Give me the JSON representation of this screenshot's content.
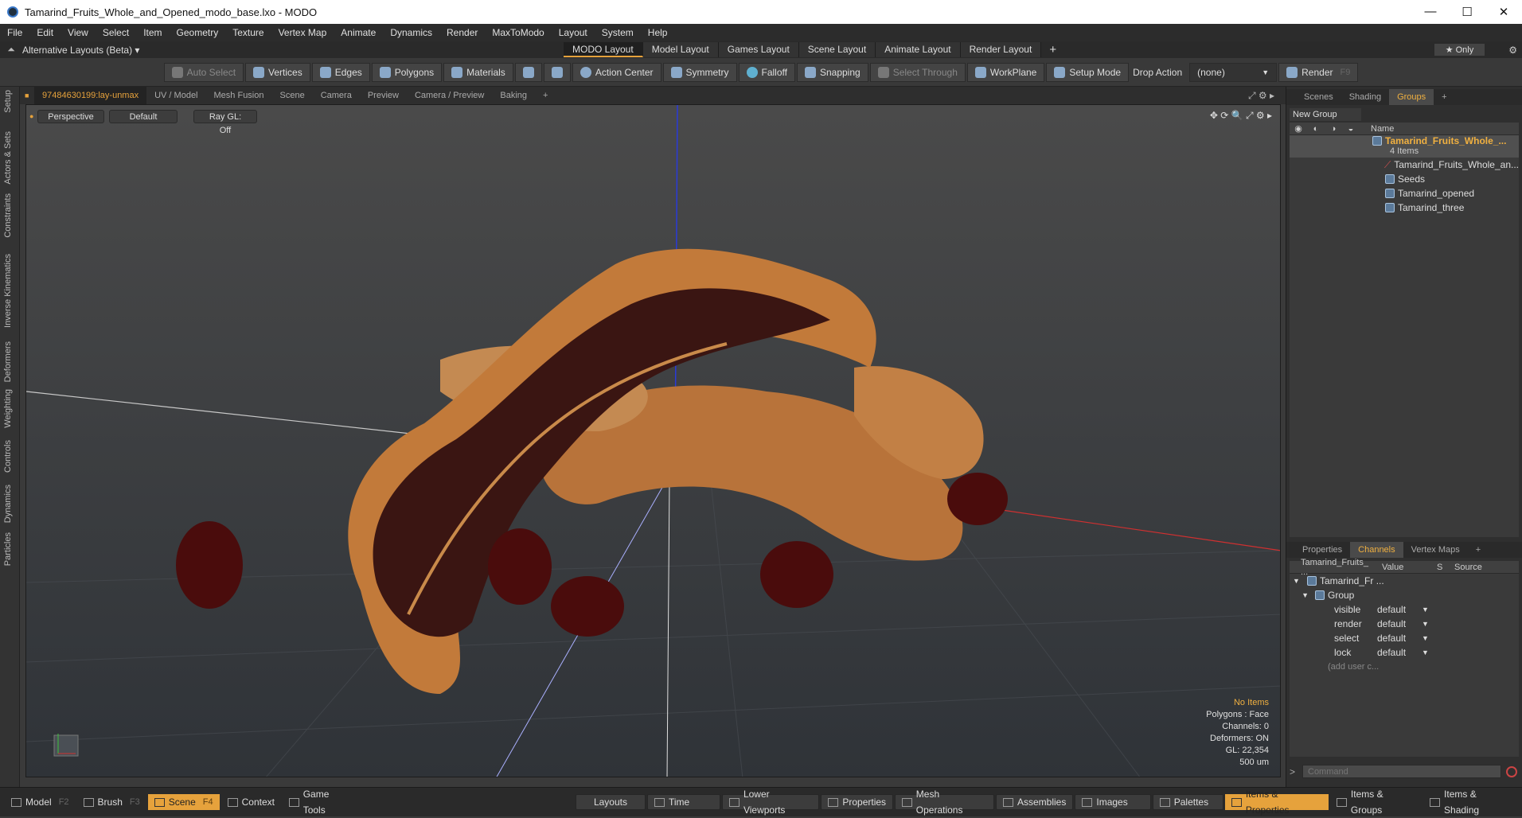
{
  "window": {
    "title": "Tamarind_Fruits_Whole_and_Opened_modo_base.lxo - MODO",
    "controls": [
      "—",
      "☐",
      "✕"
    ]
  },
  "menu": [
    "File",
    "Edit",
    "View",
    "Select",
    "Item",
    "Geometry",
    "Texture",
    "Vertex Map",
    "Animate",
    "Dynamics",
    "Render",
    "MaxToModo",
    "Layout",
    "System",
    "Help"
  ],
  "layoutbar": {
    "alt_layouts": "Alternative Layouts (Beta) ▾",
    "tabs": [
      "MODO Layout",
      "Model Layout",
      "Games Layout",
      "Scene Layout",
      "Animate Layout",
      "Render Layout"
    ],
    "add": "+",
    "only": "★ Only"
  },
  "toolbar": {
    "auto_select": "Auto Select",
    "vertices": "Vertices",
    "edges": "Edges",
    "polygons": "Polygons",
    "materials": "Materials",
    "action_center": "Action Center",
    "symmetry": "Symmetry",
    "falloff": "Falloff",
    "snapping": "Snapping",
    "select_through": "Select Through",
    "workplane": "WorkPlane",
    "setup_mode": "Setup Mode",
    "drop_action": "Drop Action",
    "drop_value": "(none)",
    "render": "Render",
    "render_key": "F9"
  },
  "left_tabs": [
    "Setup",
    "Actors & Sets",
    "Constraints",
    "Inverse Kinematics",
    "Deformers",
    "Weighting",
    "Controls",
    "Dynamics",
    "Particles"
  ],
  "viewport_tabs": [
    "97484630199:lay-unmax",
    "UV / Model",
    "Mesh Fusion",
    "Scene",
    "Camera",
    "Preview",
    "Camera / Preview",
    "Baking",
    "+"
  ],
  "viewport": {
    "view": "Perspective",
    "shading": "Default",
    "raygl": "Ray GL: Off",
    "info": {
      "items": "No Items",
      "polygons": "Polygons : Face",
      "channels": "Channels: 0",
      "deformers": "Deformers: ON",
      "gl": "GL: 22,354",
      "scale": "500 um"
    }
  },
  "groups_panel": {
    "tabs": [
      "Scenes",
      "Shading",
      "Groups",
      "+"
    ],
    "new_group": "New Group",
    "col_name": "Name",
    "root": "Tamarind_Fruits_Whole_...",
    "root_count": "4 Items",
    "children": [
      "Tamarind_Fruits_Whole_an...",
      "Seeds",
      "Tamarind_opened",
      "Tamarind_three"
    ]
  },
  "channels_panel": {
    "tabs": [
      "Properties",
      "Channels",
      "Vertex Maps",
      "+"
    ],
    "cols": [
      "Tamarind_Fruits_ ...",
      "Value",
      "S",
      "Source"
    ],
    "root": "Tamarind_Fr ...",
    "group": "Group",
    "rows": [
      {
        "name": "visible",
        "value": "default"
      },
      {
        "name": "render",
        "value": "default"
      },
      {
        "name": "select",
        "value": "default"
      },
      {
        "name": "lock",
        "value": "default"
      }
    ],
    "add_user": "(add user c..."
  },
  "command": {
    "prompt": ">",
    "placeholder": "Command"
  },
  "bottombar": {
    "left": [
      {
        "label": "Model",
        "key": "F2"
      },
      {
        "label": "Brush",
        "key": "F3"
      },
      {
        "label": "Scene",
        "key": "F4"
      },
      {
        "label": "Context",
        "key": ""
      },
      {
        "label": "Game Tools",
        "key": ""
      }
    ],
    "mid": [
      "Layouts",
      "Time",
      "Lower Viewports",
      "Properties",
      "Mesh Operations",
      "Assemblies",
      "Images"
    ],
    "right": [
      "Palettes",
      "Items & Properties",
      "Items & Groups",
      "Items & Shading"
    ]
  },
  "colors": {
    "accent": "#e6a23c",
    "fruit": "#b8733a",
    "seed": "#4a0c0c"
  }
}
